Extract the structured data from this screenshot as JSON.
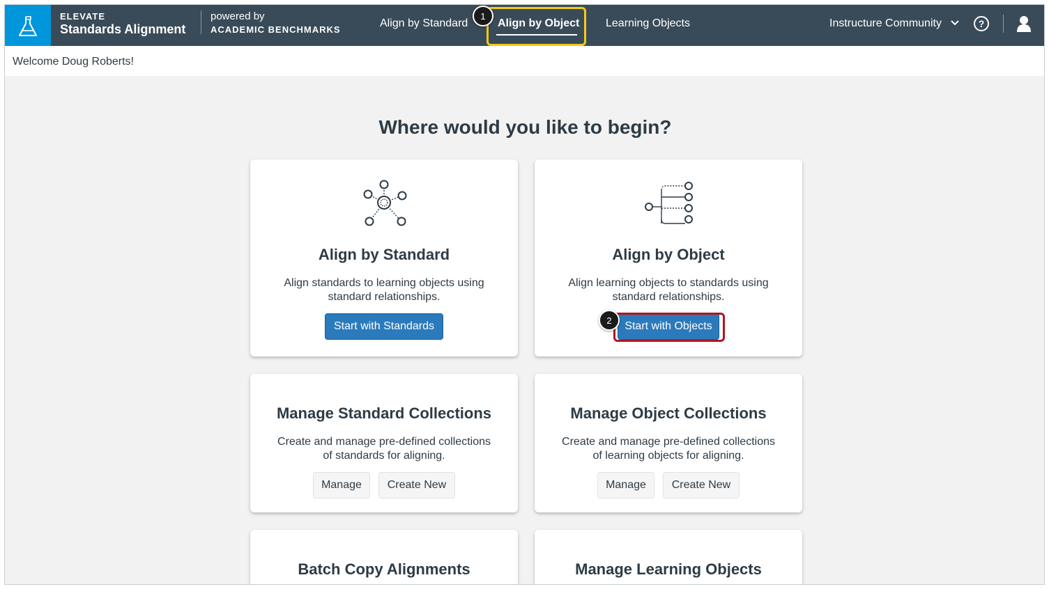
{
  "header": {
    "brand_small": "ELEVATE",
    "brand_big": "Standards Alignment",
    "powered_by": "powered by",
    "partner": "ACADEMIC BENCHMARKS",
    "nav": {
      "align_by_standard": "Align by Standard",
      "align_by_object": "Align by Object",
      "learning_objects": "Learning Objects"
    },
    "community": "Instructure Community",
    "help_glyph": "?",
    "logo_color": "#0096db",
    "bar_color": "#394b58"
  },
  "annotations": {
    "step1": "1",
    "step2": "2",
    "step1_color": "#f6c915",
    "step2_color": "#b0161e"
  },
  "welcome": "Welcome Doug Roberts!",
  "main": {
    "title": "Where would you like to begin?",
    "cards": {
      "standard": {
        "icon": "network-icon",
        "title": "Align by Standard",
        "desc": "Align standards to learning objects using standard relationships.",
        "button": "Start with Standards"
      },
      "object": {
        "icon": "tree-branch-icon",
        "title": "Align by Object",
        "desc": "Align learning objects to standards using standard relationships.",
        "button": "Start with Objects"
      },
      "std_collections": {
        "title": "Manage Standard Collections",
        "desc": "Create and manage pre-defined collections of standards for aligning.",
        "manage": "Manage",
        "create": "Create New"
      },
      "obj_collections": {
        "title": "Manage Object Collections",
        "desc": "Create and manage pre-defined collections of learning objects for aligning.",
        "manage": "Manage",
        "create": "Create New"
      },
      "batch_copy": {
        "title": "Batch Copy Alignments"
      },
      "manage_lo": {
        "title": "Manage Learning Objects"
      }
    }
  }
}
